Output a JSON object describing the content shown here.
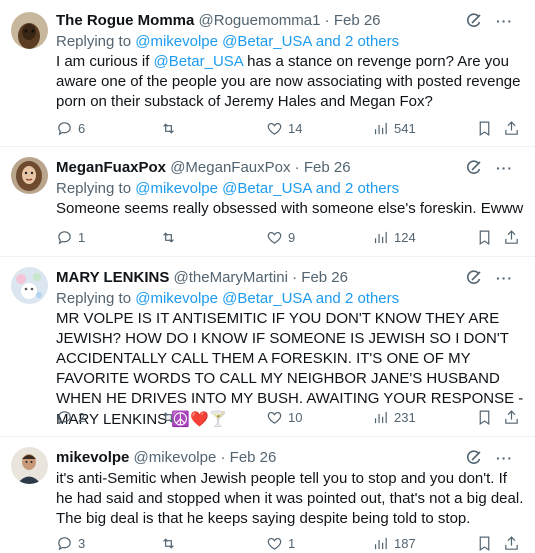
{
  "tweets": [
    {
      "name": "The Rogue Momma",
      "handle": "@Roguemomma1",
      "sep": "·",
      "date": "Feb 26",
      "reply_prefix": "Replying to ",
      "reply_to": "@mikevolpe @Betar_USA and 2 others",
      "text_pre": "I am curious if ",
      "text_link": "@Betar_USA",
      "text_post": " has a stance on revenge porn?  Are you aware one of the people you are now associating with posted revenge porn on their substack of Jeremy Hales and Megan Fox?",
      "replies": "6",
      "retweets": "",
      "likes": "14",
      "views": "541",
      "avatar_color": "#8a6a4a"
    },
    {
      "name": "MeganFuaxPox",
      "handle": "@MeganFauxPox",
      "sep": "·",
      "date": "Feb 26",
      "reply_prefix": "Replying to ",
      "reply_to": "@mikevolpe @Betar_USA and 2 others",
      "text": "Someone seems really obsessed with someone else's foreskin. Ewww",
      "replies": "1",
      "retweets": "",
      "likes": "9",
      "views": "124",
      "avatar_color": "#a0785a"
    },
    {
      "name": "MARY LENKINS",
      "handle": "@theMaryMartini",
      "sep": "·",
      "date": "Feb 26",
      "reply_prefix": "Replying to ",
      "reply_to": "@mikevolpe @Betar_USA and 2 others",
      "text": "MR VOLPE IS IT ANTISEMITIC IF YOU DON'T KNOW THEY ARE JEWISH? HOW DO I KNOW IF SOMEONE IS JEWISH SO I DON'T ACCIDENTALLY CALL THEM A FORESKIN. IT'S ONE OF MY FAVORITE WORDS TO CALL MY NEIGHBOR JANE'S HUSBAND WHEN HE DRIVES INTO MY BUSH. AWAITING YOUR RESPONSE -MARY LENKINS",
      "emojis": "☮️❤️🍸",
      "replies": "2",
      "retweets": "",
      "likes": "10",
      "views": "231",
      "avatar_color": "#c9d6e6"
    },
    {
      "name": "mikevolpe",
      "handle": "@mikevolpe",
      "sep": "·",
      "date": "Feb 26",
      "text": "it's anti-Semitic when Jewish people tell you to stop and you don't. If he had said and stopped when it was pointed out, that's not a big deal. The big deal is that he keeps saying despite being told to stop.",
      "replies": "3",
      "retweets": "",
      "likes": "1",
      "views": "187",
      "avatar_color": "#6b5a4a"
    }
  ],
  "icons": {
    "more": "···",
    "grok": "grok-icon",
    "reply": "reply-icon",
    "retweet": "retweet-icon",
    "like": "heart-icon",
    "views": "views-icon",
    "bookmark": "bookmark-icon",
    "share": "share-icon"
  },
  "colors": {
    "link": "#1d9bf0",
    "muted": "#536471",
    "text": "#0f1419"
  }
}
